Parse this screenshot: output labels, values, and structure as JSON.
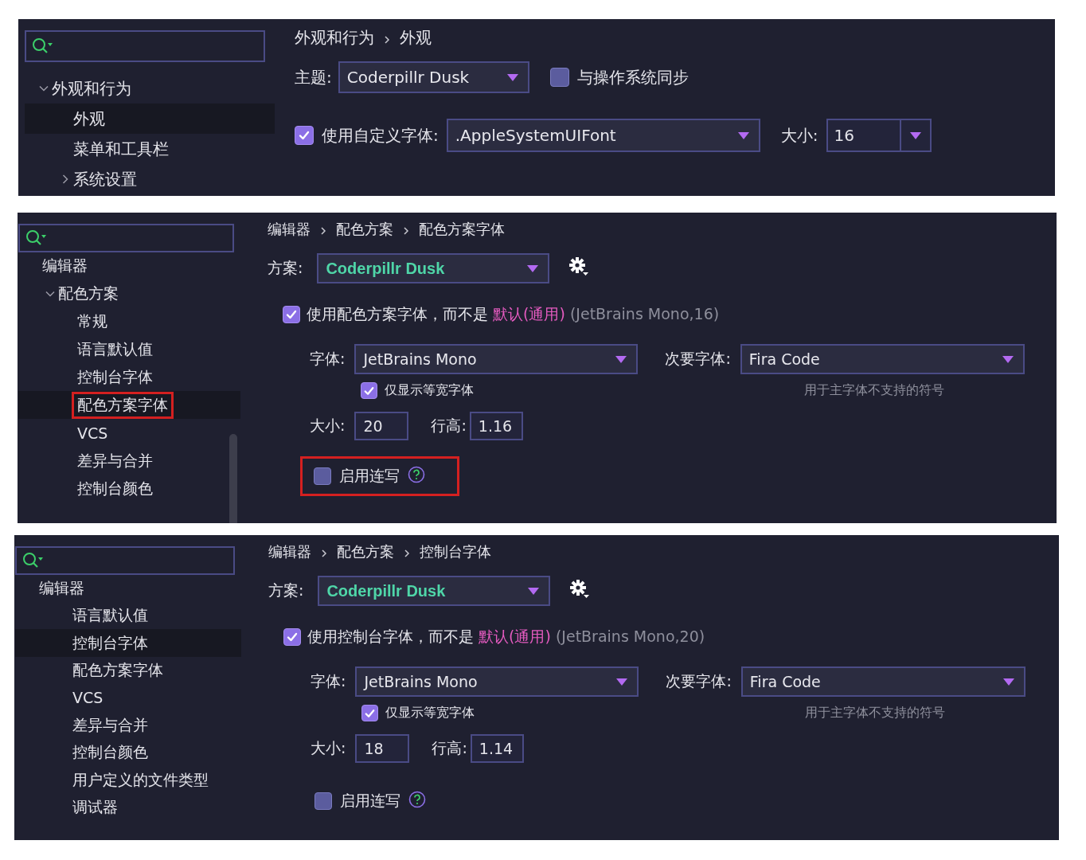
{
  "panels": [
    {
      "kind": "appearance",
      "sidebar": {
        "tree": [
          {
            "label": "外观和行为",
            "expanded": true,
            "selected": false,
            "highlighted": false,
            "children": [
              {
                "label": "外观",
                "selected": true,
                "highlighted": false
              },
              {
                "label": "菜单和工具栏",
                "selected": false,
                "highlighted": false
              },
              {
                "label": "系统设置",
                "expanded": false,
                "selected": false,
                "highlighted": false
              }
            ]
          }
        ]
      },
      "breadcrumb": [
        "外观和行为",
        "外观"
      ],
      "theme": {
        "label": "主题:",
        "value": "Coderpillr Dusk"
      },
      "sync": {
        "label": "与操作系统同步",
        "checked": false
      },
      "custom_font": {
        "label": "使用自定义字体:",
        "checked": true,
        "value": ".AppleSystemUIFont"
      },
      "size": {
        "label": "大小:",
        "value": "16"
      }
    },
    {
      "kind": "font",
      "sidebar": {
        "header": "编辑器",
        "tree": [
          {
            "label": "配色方案",
            "expanded": true,
            "selected": false,
            "highlighted": false,
            "children": [
              {
                "label": "常规",
                "selected": false,
                "highlighted": false
              },
              {
                "label": "语言默认值",
                "selected": false,
                "highlighted": false
              },
              {
                "label": "控制台字体",
                "selected": false,
                "highlighted": false
              },
              {
                "label": "配色方案字体",
                "selected": true,
                "highlighted": true
              },
              {
                "label": "VCS",
                "selected": false,
                "highlighted": false
              },
              {
                "label": "差异与合并",
                "selected": false,
                "highlighted": false
              },
              {
                "label": "控制台颜色",
                "selected": false,
                "highlighted": false
              }
            ]
          }
        ]
      },
      "breadcrumb": [
        "编辑器",
        "配色方案",
        "配色方案字体"
      ],
      "scheme": {
        "label": "方案:",
        "value": "Coderpillr Dusk"
      },
      "use_font": {
        "text": "使用配色方案字体，而不是",
        "link": "默认(通用)",
        "detail": "(JetBrains Mono,16)",
        "checked": true
      },
      "font": {
        "label": "字体:",
        "value": "JetBrains Mono"
      },
      "fallback": {
        "label": "次要字体:",
        "value": "Fira Code",
        "hint": "用于主字体不支持的符号"
      },
      "monospaced": {
        "label": "仅显示等宽字体",
        "checked": true
      },
      "size": {
        "label": "大小:",
        "value": "20"
      },
      "line_height": {
        "label": "行高:",
        "value": "1.16"
      },
      "ligatures": {
        "label": "启用连写",
        "checked": false,
        "highlighted": true
      }
    },
    {
      "kind": "font",
      "sidebar": {
        "header": "编辑器",
        "tree": [
          {
            "label": "语言默认值",
            "selected": false,
            "highlighted": false
          },
          {
            "label": "控制台字体",
            "selected": true,
            "highlighted": false
          },
          {
            "label": "配色方案字体",
            "selected": false,
            "highlighted": false
          },
          {
            "label": "VCS",
            "selected": false,
            "highlighted": false
          },
          {
            "label": "差异与合并",
            "selected": false,
            "highlighted": false
          },
          {
            "label": "控制台颜色",
            "selected": false,
            "highlighted": false
          },
          {
            "label": "用户定义的文件类型",
            "selected": false,
            "highlighted": false
          },
          {
            "label": "调试器",
            "selected": false,
            "highlighted": false
          }
        ]
      },
      "breadcrumb": [
        "编辑器",
        "配色方案",
        "控制台字体"
      ],
      "scheme": {
        "label": "方案:",
        "value": "Coderpillr Dusk"
      },
      "use_font": {
        "text": "使用控制台字体，而不是",
        "link": "默认(通用)",
        "detail": "(JetBrains Mono,20)",
        "checked": true
      },
      "font": {
        "label": "字体:",
        "value": "JetBrains Mono"
      },
      "fallback": {
        "label": "次要字体:",
        "value": "Fira Code",
        "hint": "用于主字体不支持的符号"
      },
      "monospaced": {
        "label": "仅显示等宽字体",
        "checked": true
      },
      "size": {
        "label": "大小:",
        "value": "18"
      },
      "line_height": {
        "label": "行高:",
        "value": "1.14"
      },
      "ligatures": {
        "label": "启用连写",
        "checked": false,
        "highlighted": false
      }
    }
  ]
}
